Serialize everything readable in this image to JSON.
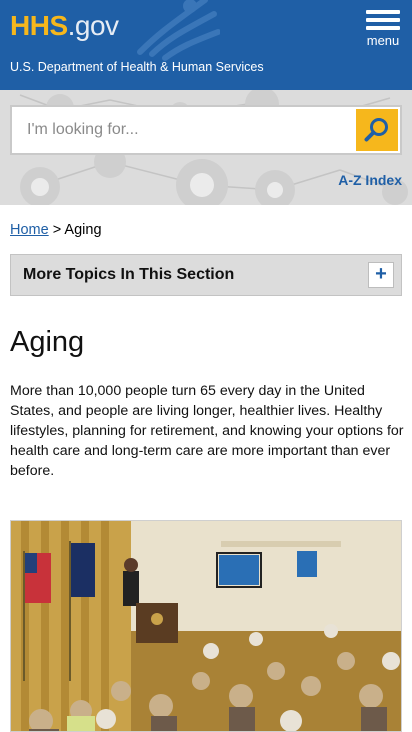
{
  "header": {
    "logo_hhs": "HHS",
    "logo_gov": ".gov",
    "tagline": "U.S. Department of Health & Human Services",
    "menu_label": "menu",
    "brand_color": "#1f5fa6",
    "accent_color": "#f6b71c"
  },
  "search": {
    "placeholder": "I'm looking for...",
    "value": "",
    "button_icon": "search-icon",
    "az_index": "A-Z Index"
  },
  "breadcrumb": {
    "home": "Home",
    "separator": " > ",
    "current": "Aging"
  },
  "more_topics": {
    "label": "More Topics In This Section",
    "toggle": "+"
  },
  "main": {
    "title": "Aging",
    "intro": "More than 10,000 people turn 65 every day in the United States, and people are living longer, healthier lives. Healthy lifestyles, planning for retirement, and knowing your options for health care and long-term care are more important than ever before."
  }
}
